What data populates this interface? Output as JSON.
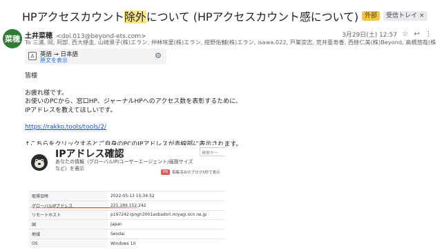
{
  "subject": {
    "part1": "HPアクセスカウント",
    "highlight": "除外",
    "part2": "について (HPアクセスカウント感について)",
    "label_external": "外部",
    "label_inbox": "受信トレイ",
    "label_remove": "×"
  },
  "sender": {
    "avatar_text": "菜穂",
    "name": "土井菜穂",
    "email": "<doi.013@beyond-ets.com>",
    "date": "3月29日(土) 12:57",
    "to_line": "To 三浦, 岡, 阿部, 西大條圭, 山崎景子(株)エラン, 仲林咲里(株)エラン, 紺野佑輔(株)エラン, isawa.022, 戸巣崇志, 荒井亜寿香, 西條仁美(株)Beyond, 高橋悠哉(株)Beyond, 羽島千尋(株)Beyond"
  },
  "translate": {
    "lang": "英語 → 日本語",
    "show_original": "原文を表示"
  },
  "body": {
    "greeting": "皆様",
    "line1": "お疲れ様です。",
    "line2": "お使いのPCから、窓口HP、ジャーナルHPへのアクセス数を表彰するために、",
    "line3": "IPアドレスを教えてほしいです。",
    "link": "https://rakko.tools/tools/2/",
    "line4": "↑こちらをクリックするとご自身のPCのIPアドレスが赤線部に表示されます。"
  },
  "screenshot": {
    "title": "IPアドレス確認",
    "desc": "あなたの情報（グローバルIP/ユーザーエージェント/画面サイズなど）を表示",
    "search_placeholder": "検索キー",
    "pr_badge": "PR",
    "pr_text": "稿集済みのブログ5秒で表示",
    "rows": [
      {
        "k": "取得日時",
        "v": "2022-05-13 15:34:52"
      },
      {
        "k": "グローバルIPアドレス",
        "v": "221.189.152.242"
      },
      {
        "k": "リモートホスト",
        "v": "p197242-ipngn3001aobadori.miyagi.ocn.ne.jp"
      },
      {
        "k": "国",
        "v": "Japan"
      },
      {
        "k": "地域",
        "v": "Sendai"
      },
      {
        "k": "OS",
        "v": "Windows 10"
      }
    ]
  },
  "colors": {
    "external_badge": "#f6c545",
    "link": "#1a4fc8",
    "avatar": "#2e7d32",
    "underline": "#d93025"
  },
  "icons": [
    "translate-icon",
    "gear-icon",
    "star-icon",
    "reply-icon",
    "more-icon",
    "rakko-logo-icon"
  ]
}
